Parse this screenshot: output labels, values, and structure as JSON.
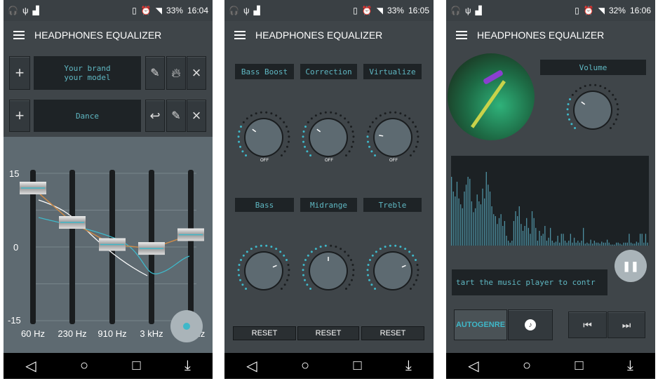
{
  "accent": "#3fb8c9",
  "screens": [
    {
      "status": {
        "battery": "33%",
        "time": "16:04"
      },
      "title": "HEADPHONES EQUALIZER",
      "headphone_display": "Your brand\nyour model",
      "preset_display": "Dance",
      "eq": {
        "y_ticks": [
          "15",
          "0",
          "-15"
        ],
        "bands": [
          "60 Hz",
          "230 Hz",
          "910 Hz",
          "3 kHz",
          "14 kHz"
        ],
        "gains_db": [
          12,
          5,
          0.5,
          -0.3,
          2.5
        ],
        "ylim": [
          -15,
          15
        ]
      }
    },
    {
      "status": {
        "battery": "33%",
        "time": "16:05"
      },
      "title": "HEADPHONES EQUALIZER",
      "effects": [
        {
          "label": "Bass Boost",
          "state": "OFF",
          "level": 0.3
        },
        {
          "label": "Correction",
          "state": "OFF",
          "level": 0.3
        },
        {
          "label": "Virtualize",
          "state": "OFF",
          "level": 0.2
        }
      ],
      "tones": [
        {
          "label": "Bass",
          "level": 0.75
        },
        {
          "label": "Midrange",
          "level": 0.5
        },
        {
          "label": "Treble",
          "level": 0.75
        }
      ],
      "reset_label": "RESET"
    },
    {
      "status": {
        "battery": "32%",
        "time": "16:06"
      },
      "title": "HEADPHONES EQUALIZER",
      "volume_label": "Volume",
      "volume_level": 0.3,
      "message": "tart the music player to contr",
      "autogenre_label": "AUTOGENRE",
      "spectrum": [
        70,
        55,
        50,
        65,
        48,
        42,
        38,
        55,
        62,
        70,
        68,
        45,
        34,
        38,
        52,
        45,
        42,
        58,
        48,
        75,
        62,
        55,
        40,
        32,
        30,
        22,
        28,
        32,
        20,
        25,
        10,
        5,
        3,
        5,
        25,
        35,
        30,
        40,
        22,
        15,
        20,
        28,
        18,
        12,
        35,
        28,
        18,
        5,
        15,
        10,
        12,
        20,
        5,
        8,
        18,
        5,
        3,
        4,
        10,
        3,
        12,
        12,
        5,
        3,
        5,
        12,
        3,
        8,
        3,
        5,
        3,
        5,
        18,
        2,
        3,
        2,
        6,
        2,
        5,
        3,
        3,
        2,
        4,
        3,
        3,
        6,
        3,
        1,
        1,
        1,
        3,
        3,
        2,
        1,
        3,
        3,
        3,
        12,
        3,
        2,
        2,
        4,
        3,
        12,
        12,
        3,
        12,
        3
      ]
    }
  ]
}
